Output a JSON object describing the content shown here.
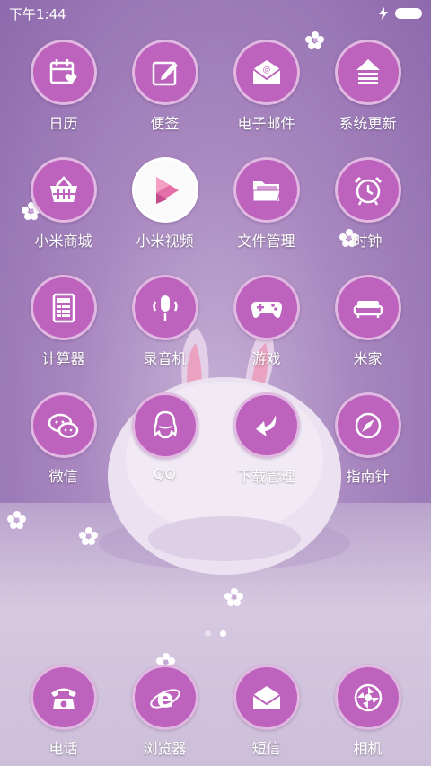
{
  "status_bar": {
    "time": "下午1:44"
  },
  "apps": [
    {
      "label": "日历",
      "icon": "calendar-icon"
    },
    {
      "label": "便签",
      "icon": "notes-icon"
    },
    {
      "label": "电子邮件",
      "icon": "email-icon"
    },
    {
      "label": "系统更新",
      "icon": "update-icon"
    },
    {
      "label": "小米商城",
      "icon": "shop-basket-icon"
    },
    {
      "label": "小米视频",
      "icon": "video-play-icon"
    },
    {
      "label": "文件管理",
      "icon": "folder-icon"
    },
    {
      "label": "时钟",
      "icon": "alarm-clock-icon"
    },
    {
      "label": "计算器",
      "icon": "calculator-icon"
    },
    {
      "label": "录音机",
      "icon": "microphone-icon"
    },
    {
      "label": "游戏",
      "icon": "gamepad-icon"
    },
    {
      "label": "米家",
      "icon": "sofa-icon"
    },
    {
      "label": "微信",
      "icon": "wechat-icon"
    },
    {
      "label": "QQ",
      "icon": "qq-penguin-icon"
    },
    {
      "label": "下载管理",
      "icon": "download-arrow-icon"
    },
    {
      "label": "指南针",
      "icon": "compass-icon"
    }
  ],
  "dock": [
    {
      "label": "电话",
      "icon": "phone-icon"
    },
    {
      "label": "浏览器",
      "icon": "browser-icon"
    },
    {
      "label": "短信",
      "icon": "message-icon"
    },
    {
      "label": "相机",
      "icon": "camera-icon"
    }
  ],
  "pages": {
    "count": 2,
    "active": 2
  },
  "colors": {
    "icon_bg": "#bd62bd",
    "label": "#ffffff"
  }
}
